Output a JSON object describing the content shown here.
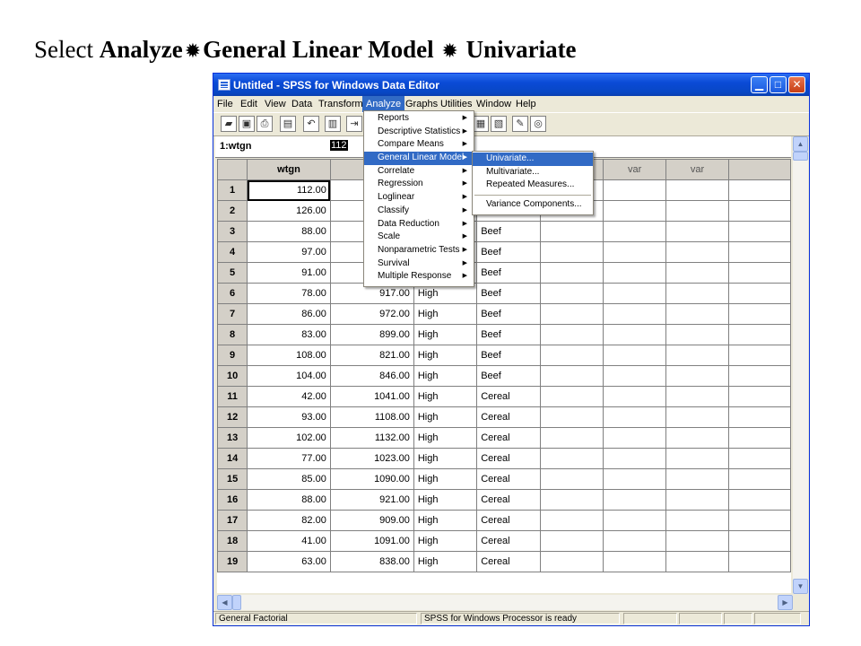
{
  "slide": {
    "select": "Select",
    "analyze": "Analyze",
    "glm": "General Linear Model",
    "univariate": "Univariate"
  },
  "window": {
    "title": "Untitled - SPSS for Windows Data Editor",
    "min_glyph": "▁",
    "max_glyph": "□",
    "close_glyph": "✕"
  },
  "menubar": {
    "file": "File",
    "edit": "Edit",
    "view": "View",
    "data": "Data",
    "transform": "Transform",
    "analyze": "Analyze",
    "graphs": "Graphs",
    "utilities": "Utilities",
    "window": "Window",
    "help": "Help"
  },
  "cellbar": {
    "ref": "1:wtgn",
    "value": "112"
  },
  "columns": [
    "wtgn",
    "",
    "",
    "",
    "var",
    "var",
    "var"
  ],
  "rows": [
    {
      "n": "1",
      "wtgn": "112.00",
      "c2": "",
      "c3": "",
      "c4": ""
    },
    {
      "n": "2",
      "wtgn": "126.00",
      "c2": "",
      "c3": "",
      "c4": "Beef"
    },
    {
      "n": "3",
      "wtgn": "88.00",
      "c2": "",
      "c3": "",
      "c4": "Beef"
    },
    {
      "n": "4",
      "wtgn": "97.00",
      "c2": "",
      "c3": "",
      "c4": "Beef"
    },
    {
      "n": "5",
      "wtgn": "91.00",
      "c2": "",
      "c3": "",
      "c4": "Beef"
    },
    {
      "n": "6",
      "wtgn": "78.00",
      "c2": "917.00",
      "c3": "High",
      "c4": "Beef"
    },
    {
      "n": "7",
      "wtgn": "86.00",
      "c2": "972.00",
      "c3": "High",
      "c4": "Beef"
    },
    {
      "n": "8",
      "wtgn": "83.00",
      "c2": "899.00",
      "c3": "High",
      "c4": "Beef"
    },
    {
      "n": "9",
      "wtgn": "108.00",
      "c2": "821.00",
      "c3": "High",
      "c4": "Beef"
    },
    {
      "n": "10",
      "wtgn": "104.00",
      "c2": "846.00",
      "c3": "High",
      "c4": "Beef"
    },
    {
      "n": "11",
      "wtgn": "42.00",
      "c2": "1041.00",
      "c3": "High",
      "c4": "Cereal"
    },
    {
      "n": "12",
      "wtgn": "93.00",
      "c2": "1108.00",
      "c3": "High",
      "c4": "Cereal"
    },
    {
      "n": "13",
      "wtgn": "102.00",
      "c2": "1132.00",
      "c3": "High",
      "c4": "Cereal"
    },
    {
      "n": "14",
      "wtgn": "77.00",
      "c2": "1023.00",
      "c3": "High",
      "c4": "Cereal"
    },
    {
      "n": "15",
      "wtgn": "85.00",
      "c2": "1090.00",
      "c3": "High",
      "c4": "Cereal"
    },
    {
      "n": "16",
      "wtgn": "88.00",
      "c2": "921.00",
      "c3": "High",
      "c4": "Cereal"
    },
    {
      "n": "17",
      "wtgn": "82.00",
      "c2": "909.00",
      "c3": "High",
      "c4": "Cereal"
    },
    {
      "n": "18",
      "wtgn": "41.00",
      "c2": "1091.00",
      "c3": "High",
      "c4": "Cereal"
    },
    {
      "n": "19",
      "wtgn": "63.00",
      "c2": "838.00",
      "c3": "High",
      "c4": "Cereal"
    }
  ],
  "analyze_menu": [
    "Reports",
    "Descriptive Statistics",
    "Compare Means",
    "General Linear Model",
    "Correlate",
    "Regression",
    "Loglinear",
    "Classify",
    "Data Reduction",
    "Scale",
    "Nonparametric Tests",
    "Survival",
    "Multiple Response"
  ],
  "glm_submenu": {
    "univariate": "Univariate...",
    "multivariate": "Multivariate...",
    "repeated": "Repeated Measures...",
    "variance": "Variance Components..."
  },
  "status": {
    "left": "General Factorial",
    "processor": "SPSS for Windows Processor is ready"
  },
  "colors": {
    "highlight": "#316ac5",
    "titlebar": "#0a4ad6",
    "chrome": "#ece9d8"
  }
}
